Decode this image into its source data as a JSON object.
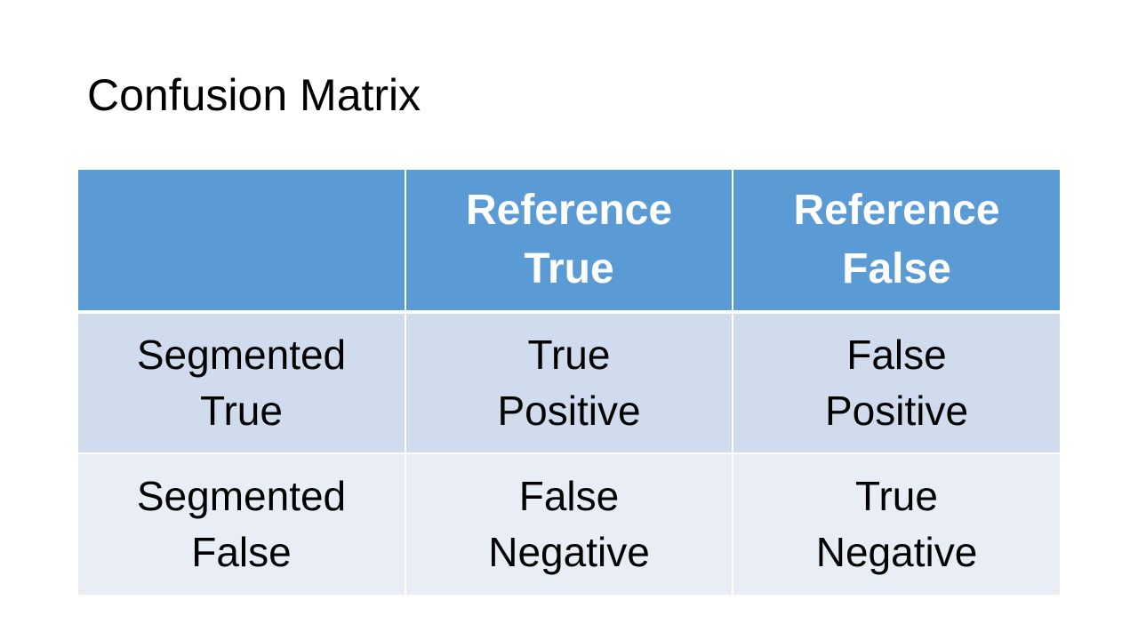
{
  "slide": {
    "title": "Confusion Matrix"
  },
  "table": {
    "header": [
      "",
      "Reference\nTrue",
      "Reference\nFalse"
    ],
    "rows": [
      [
        "Segmented\nTrue",
        "True\nPositive",
        "False\nPositive"
      ],
      [
        "Segmented\nFalse",
        "False\nNegative",
        "True\nNegative"
      ]
    ]
  },
  "colors": {
    "header_background": "#5b9bd5",
    "row_odd_background": "#d0dcee",
    "row_even_background": "#e9edf6",
    "header_text": "#ffffff",
    "body_text": "#000000"
  }
}
